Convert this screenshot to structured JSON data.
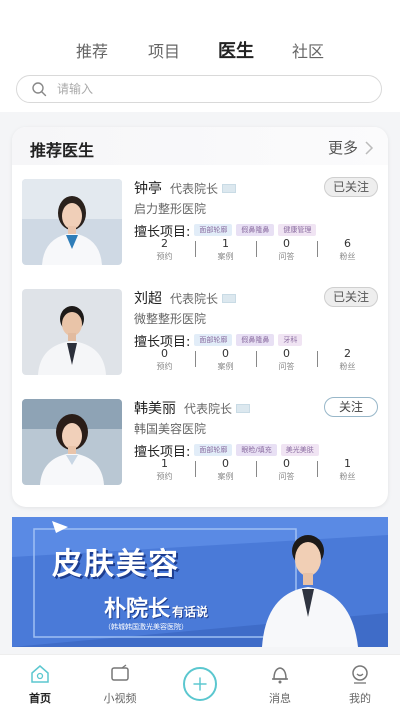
{
  "tabs": [
    "推荐",
    "项目",
    "医生",
    "社区"
  ],
  "active_tab": 2,
  "search": {
    "placeholder": "请输入"
  },
  "section": {
    "title": "推荐医生",
    "more_label": "更多"
  },
  "doctors": [
    {
      "name": "钟亭",
      "title": "代表院长",
      "hospital": "启力整形医院",
      "follow_label": "已关注",
      "followed": true,
      "specialty_label": "擅长项目:",
      "tags": [
        "面部轮廓",
        "假鼻隆鼻",
        "健康管理"
      ],
      "stats": [
        {
          "value": "2",
          "label": "预约"
        },
        {
          "value": "1",
          "label": "案例"
        },
        {
          "value": "0",
          "label": "问答"
        },
        {
          "value": "6",
          "label": "粉丝"
        }
      ]
    },
    {
      "name": "刘超",
      "title": "代表院长",
      "hospital": "微整整形医院",
      "follow_label": "已关注",
      "followed": true,
      "specialty_label": "擅长项目:",
      "tags": [
        "面部轮廓",
        "假鼻隆鼻",
        "牙科"
      ],
      "stats": [
        {
          "value": "0",
          "label": "预约"
        },
        {
          "value": "0",
          "label": "案例"
        },
        {
          "value": "0",
          "label": "问答"
        },
        {
          "value": "2",
          "label": "粉丝"
        }
      ]
    },
    {
      "name": "韩美丽",
      "title": "代表院长",
      "hospital": "韩国美容医院",
      "follow_label": "关注",
      "followed": false,
      "specialty_label": "擅长项目:",
      "tags": [
        "面部轮廓",
        "眼睑/填充",
        "美光美肤"
      ],
      "stats": [
        {
          "value": "1",
          "label": "预约"
        },
        {
          "value": "0",
          "label": "案例"
        },
        {
          "value": "0",
          "label": "问答"
        },
        {
          "value": "1",
          "label": "粉丝"
        }
      ]
    }
  ],
  "banner": {
    "title": "皮肤美容",
    "subtitle": "朴院长",
    "subtitle_small": "有话说",
    "note": "（韩城韩国激光美容医院）"
  },
  "nav": [
    {
      "label": "首页",
      "icon": "home-icon"
    },
    {
      "label": "小视频",
      "icon": "video-icon"
    },
    {
      "label": "",
      "icon": "plus-icon"
    },
    {
      "label": "消息",
      "icon": "bell-icon"
    },
    {
      "label": "我的",
      "icon": "user-icon"
    }
  ],
  "colors": {
    "accent": "#5bc7cf",
    "banner": "#4a7ad8"
  }
}
